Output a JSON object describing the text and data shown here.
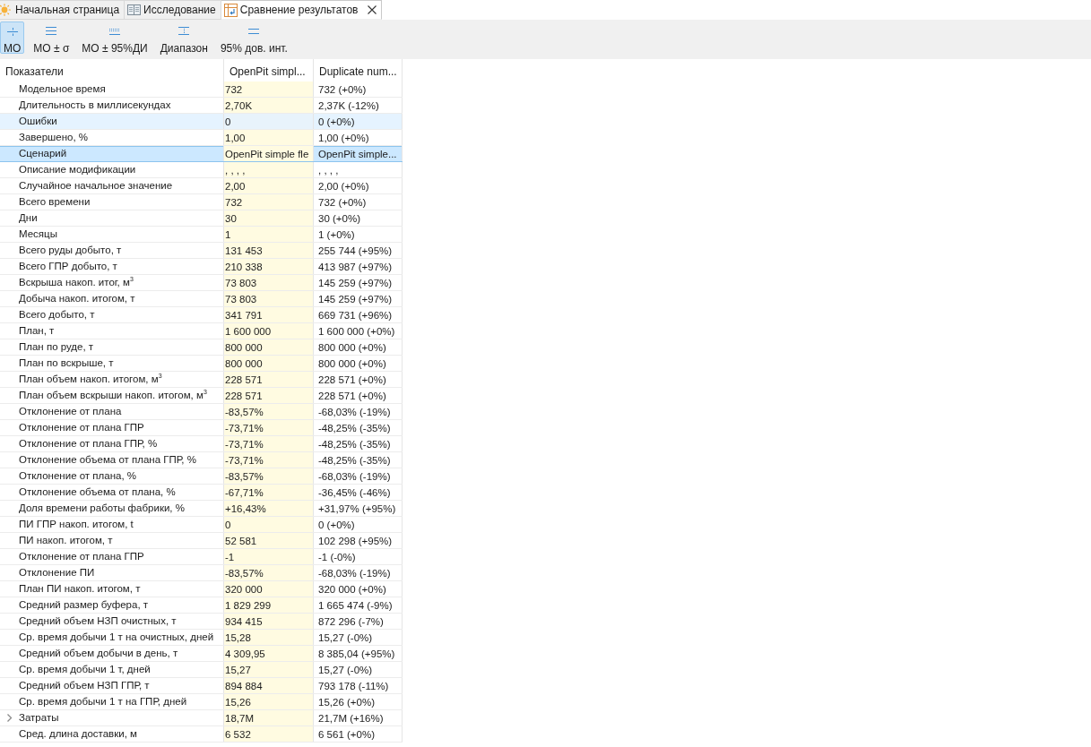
{
  "tabs": [
    {
      "label": "Начальная страница",
      "selected": false,
      "closable": false
    },
    {
      "label": "Исследование",
      "selected": false,
      "closable": false
    },
    {
      "label": "Сравнение результатов",
      "selected": true,
      "closable": true
    }
  ],
  "toolbar": {
    "buttons": [
      {
        "label": "МО",
        "selected": true
      },
      {
        "label": "МО ± σ",
        "selected": false
      },
      {
        "label": "МО ± 95%ДИ",
        "selected": false
      },
      {
        "label": "Диапазон",
        "selected": false
      },
      {
        "label": "95% дов. инт.",
        "selected": false
      }
    ]
  },
  "table": {
    "columns": [
      "Показатели",
      "OpenPit simpl...",
      "Duplicate num..."
    ],
    "rows": [
      {
        "kind": "metric",
        "label": "Модельное время",
        "values": [
          "732",
          "732 (+0%)"
        ],
        "selected": false,
        "hovered": false
      },
      {
        "kind": "metric",
        "label": "Длительность в миллисекундах",
        "values": [
          "2,70K",
          "2,37K (-12%)"
        ],
        "selected": false,
        "hovered": false
      },
      {
        "kind": "metric",
        "label": "Ошибки",
        "values": [
          "0",
          "0 (+0%)"
        ],
        "selected": false,
        "hovered": true
      },
      {
        "kind": "metric",
        "label": "Завершено, %",
        "values": [
          "1,00",
          "1,00 (+0%)"
        ],
        "selected": false,
        "hovered": false
      },
      {
        "kind": "metric",
        "label": "Сценарий",
        "values": [
          "OpenPit simple fle",
          "OpenPit simple..."
        ],
        "selected": true,
        "hovered": false
      },
      {
        "kind": "metric",
        "label": "Описание модификации",
        "values": [
          ", , , ,",
          ", , , ,"
        ],
        "selected": false,
        "hovered": false
      },
      {
        "kind": "metric",
        "label": "Случайное начальное значение",
        "values": [
          "2,00",
          "2,00 (+0%)"
        ],
        "selected": false,
        "hovered": false
      },
      {
        "kind": "metric",
        "label": "Всего времени",
        "values": [
          "732",
          "732 (+0%)"
        ],
        "selected": false,
        "hovered": false
      },
      {
        "kind": "metric",
        "label": "Дни",
        "values": [
          "30",
          "30 (+0%)"
        ],
        "selected": false,
        "hovered": false
      },
      {
        "kind": "metric",
        "label": "Месяцы",
        "values": [
          "1",
          "1 (+0%)"
        ],
        "selected": false,
        "hovered": false
      },
      {
        "kind": "metric",
        "label": "Всего руды добыто, т",
        "values": [
          "131 453",
          "255 744 (+95%)"
        ],
        "selected": false,
        "hovered": false
      },
      {
        "kind": "metric",
        "label": "Всего ГПР добыто, т",
        "values": [
          "210 338",
          "413 987 (+97%)"
        ],
        "selected": false,
        "hovered": false
      },
      {
        "kind": "metric",
        "label": "Вскрыша накоп. итог, м$^{3}$",
        "values": [
          "73 803",
          "145 259 (+97%)"
        ],
        "selected": false,
        "hovered": false
      },
      {
        "kind": "metric",
        "label": "Добыча накоп. итогом, т",
        "values": [
          "73 803",
          "145 259 (+97%)"
        ],
        "selected": false,
        "hovered": false
      },
      {
        "kind": "metric",
        "label": "Всего добыто, т",
        "values": [
          "341 791",
          "669 731 (+96%)"
        ],
        "selected": false,
        "hovered": false
      },
      {
        "kind": "metric",
        "label": "План, т",
        "values": [
          "1 600 000",
          "1 600 000 (+0%)"
        ],
        "selected": false,
        "hovered": false
      },
      {
        "kind": "metric",
        "label": "План по руде, т",
        "values": [
          "800 000",
          "800 000 (+0%)"
        ],
        "selected": false,
        "hovered": false
      },
      {
        "kind": "metric",
        "label": "План по вскрыше, т",
        "values": [
          "800 000",
          "800 000 (+0%)"
        ],
        "selected": false,
        "hovered": false
      },
      {
        "kind": "metric",
        "label": "План объем накоп. итогом, м$^{3}$",
        "values": [
          "228 571",
          "228 571 (+0%)"
        ],
        "selected": false,
        "hovered": false
      },
      {
        "kind": "metric",
        "label": "План объем вскрыши накоп. итогом, м$^{3}$",
        "values": [
          "228 571",
          "228 571 (+0%)"
        ],
        "selected": false,
        "hovered": false
      },
      {
        "kind": "metric",
        "label": "Отклонение от плана",
        "values": [
          "-83,57%",
          "-68,03% (-19%)"
        ],
        "selected": false,
        "hovered": false
      },
      {
        "kind": "metric",
        "label": "Отклонение от плана ГПР",
        "values": [
          "-73,71%",
          "-48,25% (-35%)"
        ],
        "selected": false,
        "hovered": false
      },
      {
        "kind": "metric",
        "label": "Отклонение от плана ГПР, %",
        "values": [
          "-73,71%",
          "-48,25% (-35%)"
        ],
        "selected": false,
        "hovered": false
      },
      {
        "kind": "metric",
        "label": "Отклонение объема от плана ГПР, %",
        "values": [
          "-73,71%",
          "-48,25% (-35%)"
        ],
        "selected": false,
        "hovered": false
      },
      {
        "kind": "metric",
        "label": "Отклонение от плана, %",
        "values": [
          "-83,57%",
          "-68,03% (-19%)"
        ],
        "selected": false,
        "hovered": false
      },
      {
        "kind": "metric",
        "label": "Отклонение объема от плана, %",
        "values": [
          "-67,71%",
          "-36,45% (-46%)"
        ],
        "selected": false,
        "hovered": false
      },
      {
        "kind": "metric",
        "label": "Доля времени работы фабрики, %",
        "values": [
          "+16,43%",
          "+31,97% (+95%)"
        ],
        "selected": false,
        "hovered": false
      },
      {
        "kind": "metric",
        "label": "ПИ ГПР накоп. итогом, t",
        "values": [
          "0",
          "0 (+0%)"
        ],
        "selected": false,
        "hovered": false
      },
      {
        "kind": "metric",
        "label": "ПИ накоп. итогом, т",
        "values": [
          "52 581",
          "102 298 (+95%)"
        ],
        "selected": false,
        "hovered": false
      },
      {
        "kind": "metric",
        "label": "Отклонение от плана ГПР",
        "values": [
          "-1",
          "-1 (-0%)"
        ],
        "selected": false,
        "hovered": false
      },
      {
        "kind": "metric",
        "label": "Отклонение ПИ",
        "values": [
          "-83,57%",
          "-68,03% (-19%)"
        ],
        "selected": false,
        "hovered": false
      },
      {
        "kind": "metric",
        "label": "План ПИ накоп. итогом, т",
        "values": [
          "320 000",
          "320 000 (+0%)"
        ],
        "selected": false,
        "hovered": false
      },
      {
        "kind": "metric",
        "label": "Средний размер буфера, т",
        "values": [
          "1 829 299",
          "1 665 474 (-9%)"
        ],
        "selected": false,
        "hovered": false
      },
      {
        "kind": "metric",
        "label": "Средний объем НЗП очистных, т",
        "values": [
          "934 415",
          "872 296 (-7%)"
        ],
        "selected": false,
        "hovered": false
      },
      {
        "kind": "metric",
        "label": "Ср. время добычи 1 т на очистных, дней",
        "values": [
          "15,28",
          "15,27 (-0%)"
        ],
        "selected": false,
        "hovered": false
      },
      {
        "kind": "metric",
        "label": "Средний объем добычи в день, т",
        "values": [
          "4 309,95",
          "8 385,04 (+95%)"
        ],
        "selected": false,
        "hovered": false
      },
      {
        "kind": "metric",
        "label": "Ср. время добычи 1 т, дней",
        "values": [
          "15,27",
          "15,27 (-0%)"
        ],
        "selected": false,
        "hovered": false
      },
      {
        "kind": "metric",
        "label": "Средний объем НЗП ГПР, т",
        "values": [
          "894 884",
          "793 178 (-11%)"
        ],
        "selected": false,
        "hovered": false
      },
      {
        "kind": "metric",
        "label": "Ср. время добычи 1 т на ГПР, дней",
        "values": [
          "15,26",
          "15,26 (+0%)"
        ],
        "selected": false,
        "hovered": false
      },
      {
        "kind": "group",
        "label": "Затраты",
        "values": [
          "18,7M",
          "21,7M (+16%)"
        ],
        "selected": false,
        "hovered": false,
        "expanded": false
      },
      {
        "kind": "metric",
        "label": "Сред. длина доставки, м",
        "values": [
          "6 532",
          "6 561 (+0%)"
        ],
        "selected": false,
        "hovered": false
      }
    ]
  }
}
